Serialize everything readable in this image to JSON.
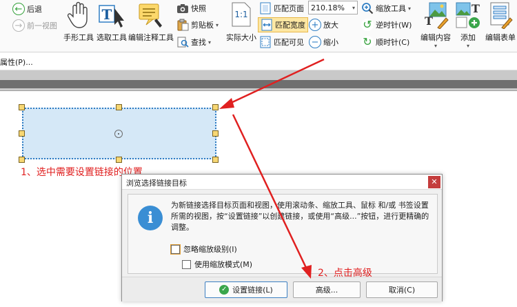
{
  "ribbon": {
    "back": "后退",
    "prev_view": "前一视图",
    "hand_tool": "手形工具",
    "select_tool": "选取工具",
    "edit_annot_tool": "编辑注释工具",
    "snapshot": "快照",
    "clipboard": "剪贴板",
    "find": "查找",
    "actual_size": "实际大小",
    "actual_size_icon_text": "1:1",
    "fit_page": "匹配页面",
    "fit_width": "匹配宽度",
    "fit_visible": "匹配可见",
    "zoom_value": "210.18%",
    "zoom_in": "放大",
    "zoom_out": "缩小",
    "zoom_tool": "缩放工具",
    "rotate_ccw": "逆时针(W)",
    "rotate_cw": "顺时针(C)",
    "edit_content": "编辑内容",
    "add": "添加",
    "edit_form": "编辑表单"
  },
  "properties_bar": {
    "label": "属性(P)..."
  },
  "annotations": {
    "step1": "1、选中需要设置链接的位置",
    "step2": "2、点击高级"
  },
  "dialog": {
    "title": "浏览选择链接目标",
    "close": "✕",
    "message": "为新链接选择目标页面和视图，使用滚动条、缩放工具、鼠标 和/或 书签设置所需的视图，按“设置链接”以创建链接，或使用“高级...”按钮，进行更精确的调整。",
    "ignore_zoom": "忽略缩放级别(I)",
    "use_zoom_mode": "使用缩放模式(M)",
    "btn_set_link": "设置链接(L)",
    "btn_advanced": "高级...",
    "btn_cancel": "取消(C)"
  },
  "colors": {
    "annotation": "#e02020",
    "link_fill": "#d5e8f7",
    "link_border": "#2d7bc3",
    "accent_blue": "#2f7ec4",
    "selected_bg": "#fde7a3"
  }
}
